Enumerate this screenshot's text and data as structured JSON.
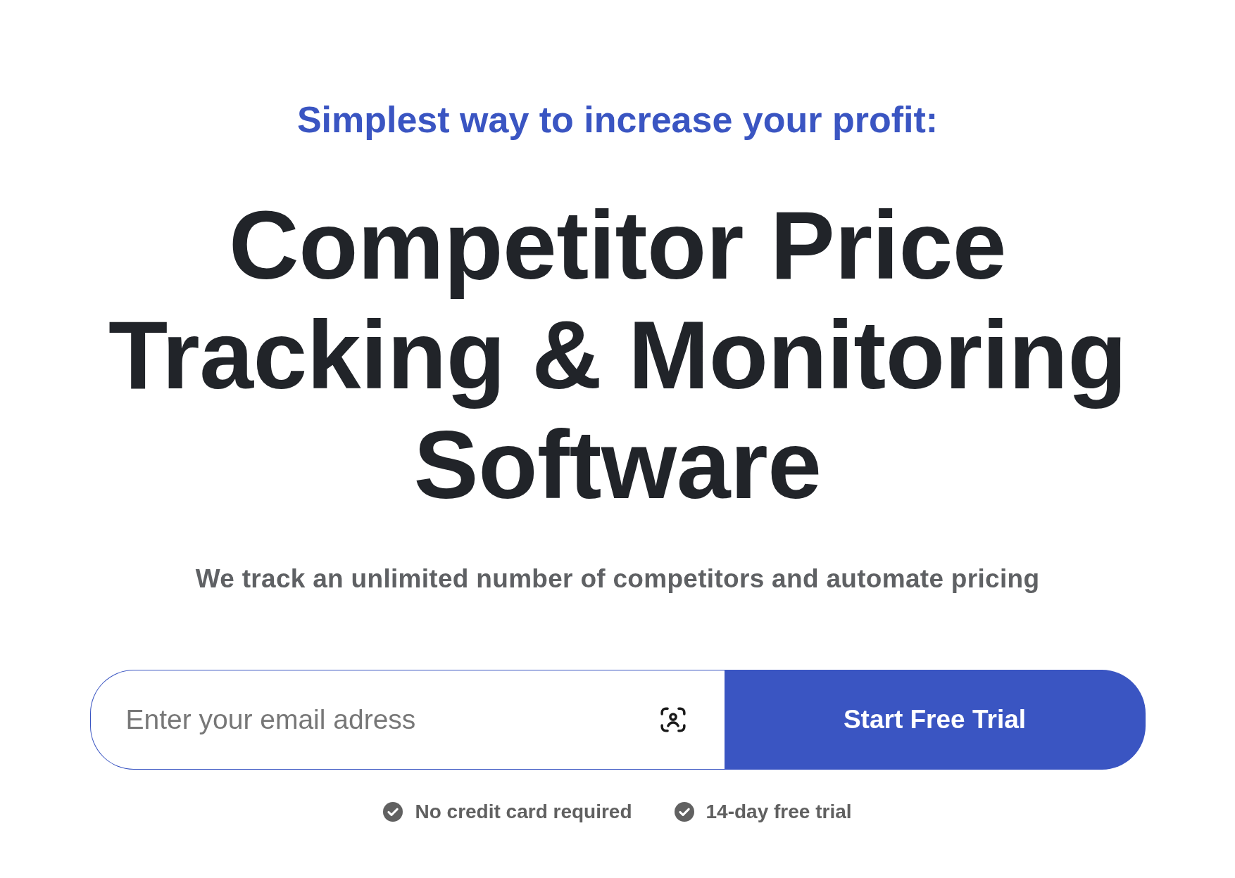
{
  "eyebrow": "Simplest way to increase your profit:",
  "heading": {
    "lines": [
      "Competitor Price",
      "Tracking & Monitoring",
      "Software"
    ]
  },
  "subtitle": "We track an unlimited number of competitors and automate pricing",
  "signup_form": {
    "email_field": {
      "placeholder": "Enter your email adress"
    },
    "submit_button": "Start Free Trial"
  },
  "benefits": [
    "No credit card required",
    "14-day free trial"
  ]
}
